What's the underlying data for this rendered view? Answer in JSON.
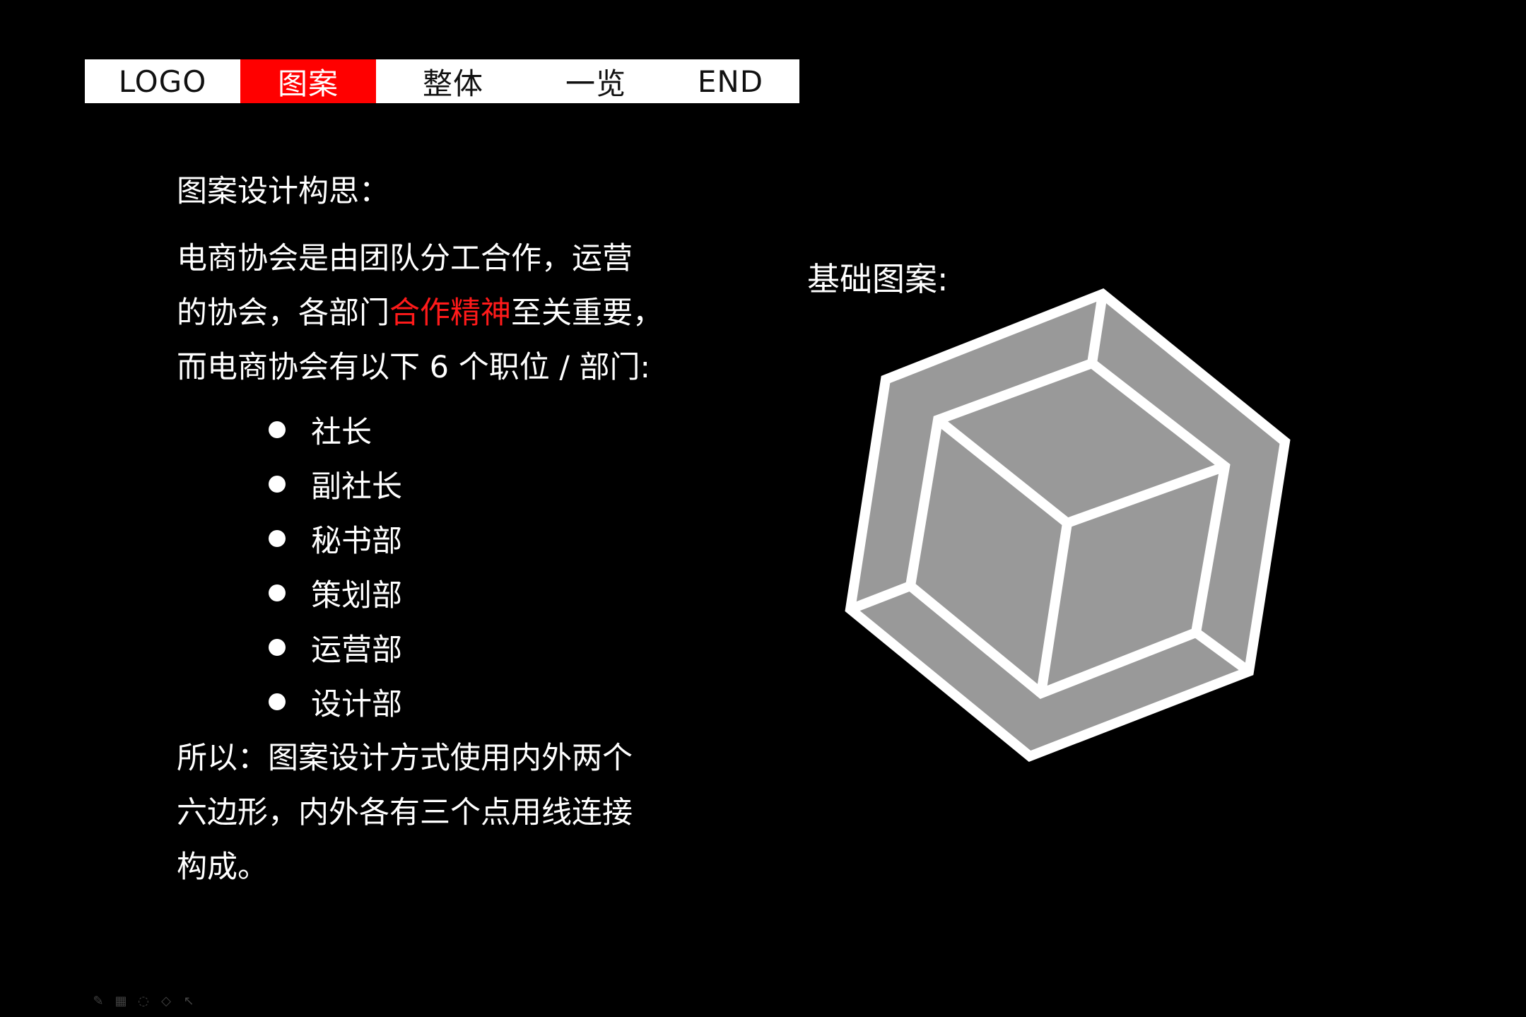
{
  "nav": {
    "active_color": "#ff0000",
    "items": [
      {
        "label": "LOGO",
        "active": false
      },
      {
        "label": "图案",
        "active": true
      },
      {
        "label": "整体",
        "active": false
      },
      {
        "label": "一览",
        "active": false
      },
      {
        "label": "END",
        "active": false
      }
    ]
  },
  "intro": {
    "heading": "图案设计构思：",
    "para_line1": "电商协会是由团队分工合作，运营",
    "para_line2_before": "的协会，各部门",
    "para_line2_highlight": "合作精神",
    "para_line2_after": "至关重要，",
    "para_line3": "而电商协会有以下 6 个职位 / 部门:",
    "highlight_color": "#ff1a1a"
  },
  "roles": [
    "社长",
    "副社长",
    "秘书部",
    "策划部",
    "运营部",
    "设计部"
  ],
  "conclusion": {
    "line1": "所以：图案设计方式使用内外两个",
    "line2": "六边形，内外各有三个点用线连接",
    "line3": "构成。"
  },
  "pattern": {
    "label": "基础图案:",
    "fill_color": "#999999",
    "stroke_color": "#ffffff"
  },
  "toolbar": {
    "icons": [
      "pen-icon",
      "keyboard-icon",
      "lasso-icon",
      "eraser-icon",
      "pointer-icon"
    ]
  }
}
